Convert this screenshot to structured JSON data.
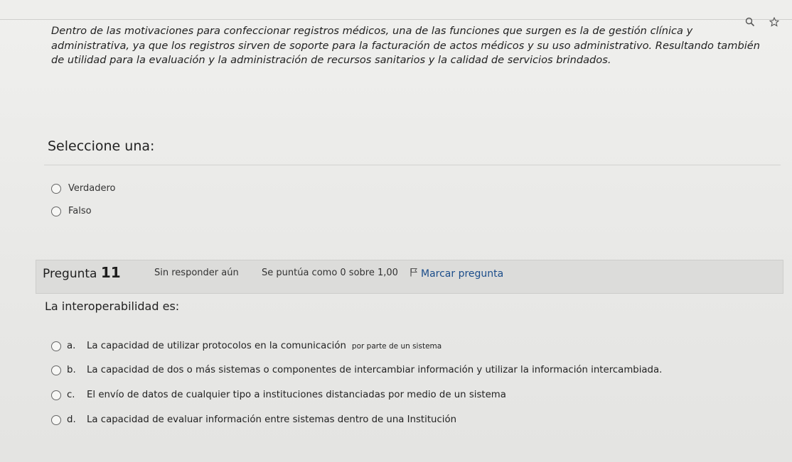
{
  "browser": {
    "icons": [
      "search-icon",
      "star-icon"
    ]
  },
  "question10": {
    "text": "Dentro de las motivaciones para confeccionar registros médicos, una de las funciones que surgen es la de gestión clínica y administrativa, ya que los registros sirven de soporte para la facturación de actos médicos y su uso administrativo. Resultando también de utilidad para la evaluación y la administración de recursos sanitarios y la calidad de servicios brindados.",
    "select_label": "Seleccione una:",
    "options": [
      "Verdadero",
      "Falso"
    ]
  },
  "question11": {
    "label": "Pregunta",
    "number": "11",
    "status": "Sin responder aún",
    "score": "Se puntúa como 0 sobre 1,00",
    "flag_label": "Marcar pregunta",
    "prompt": "La interoperabilidad es:",
    "options": [
      {
        "letter": "a.",
        "text": "La capacidad de utilizar protocolos en la comunicación",
        "tail": "por parte de un sistema"
      },
      {
        "letter": "b.",
        "text": "La capacidad de dos o más sistemas o componentes de intercambiar información y utilizar la información intercambiada.",
        "tail": ""
      },
      {
        "letter": "c.",
        "text": "El envío de datos de cualquier tipo a instituciones distanciadas por medio de un sistema",
        "tail": ""
      },
      {
        "letter": "d.",
        "text": "La capacidad de evaluar información entre sistemas dentro de una Institución",
        "tail": ""
      }
    ]
  }
}
